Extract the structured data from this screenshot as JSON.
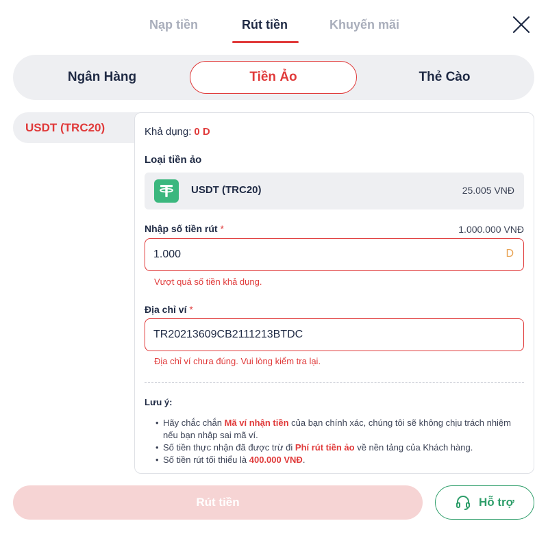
{
  "top_tabs": {
    "deposit": "Nạp tiền",
    "withdraw": "Rút tiền",
    "promotion": "Khuyến mãi"
  },
  "segments": {
    "bank": "Ngân Hàng",
    "crypto": "Tiền Ảo",
    "card": "Thẻ Cào"
  },
  "coin_list": [
    "USDT (TRC20)"
  ],
  "panel": {
    "available_label": "Khả dụng:",
    "available_value": "0 D",
    "coin_type_title": "Loại tiền ảo",
    "coin": {
      "name": "USDT (TRC20)",
      "rate": "25.005 VNĐ",
      "icon": "tether-icon"
    },
    "amount": {
      "label": "Nhập số tiền rút",
      "required_mark": "*",
      "max_hint": "1.000.000 VNĐ",
      "value": "1.000",
      "suffix": "D",
      "error": "Vượt quá số tiền khả dụng."
    },
    "wallet": {
      "label": "Địa chỉ ví",
      "required_mark": "*",
      "value": "TR20213609CB2111213BTDC",
      "error": "Địa chỉ ví chưa đúng. Vui lòng kiểm tra lại."
    },
    "notes": {
      "title": "Lưu ý:",
      "n1_a": "Hãy chắc chắn ",
      "n1_hl": "Mã ví nhận tiền",
      "n1_b": " của bạn chính xác, chúng tôi sẽ không chịu trách nhiệm nếu bạn nhập sai mã ví.",
      "n2_a": "Số tiền thực nhận đã được trừ đi ",
      "n2_hl": "Phí rút tiền ảo",
      "n2_b": " về nền tảng của Khách hàng.",
      "n3_a": "Số tiền rút tối thiểu là ",
      "n3_hl": "400.000 VNĐ",
      "n3_b": "."
    }
  },
  "buttons": {
    "submit": "Rút tiền",
    "support": "Hỗ trợ"
  },
  "colors": {
    "accent": "#e03a3a",
    "support_green": "#2e9e6a",
    "tether_green": "#3bb77e",
    "disabled_submit": "#f6d4d4"
  }
}
